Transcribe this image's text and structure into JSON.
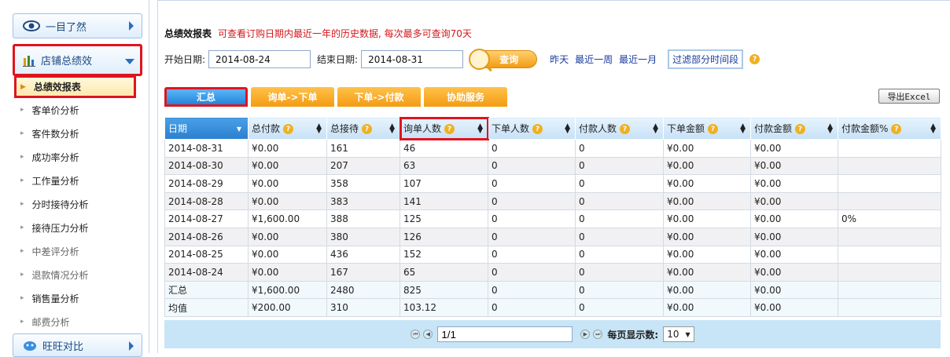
{
  "sidebar": {
    "overview_label": "一目了然",
    "shop_perf_label": "店铺总绩效",
    "items": [
      {
        "label": "总绩效报表"
      },
      {
        "label": "客单价分析"
      },
      {
        "label": "客件数分析"
      },
      {
        "label": "成功率分析"
      },
      {
        "label": "工作量分析"
      },
      {
        "label": "分时接待分析"
      },
      {
        "label": "接待压力分析"
      },
      {
        "label": "中差评分析"
      },
      {
        "label": "退款情况分析"
      },
      {
        "label": "销售量分析"
      },
      {
        "label": "邮费分析"
      }
    ],
    "wangwang_label": "旺旺对比"
  },
  "header": {
    "title": "总绩效报表",
    "note": "可查看订购日期内最近一年的历史数据, 每次最多可查询70天"
  },
  "filter": {
    "start_label": "开始日期:",
    "start_value": "2014-08-24",
    "end_label": "结束日期:",
    "end_value": "2014-08-31",
    "query_label": "查询",
    "yesterday": "昨天",
    "last_week": "最近一周",
    "last_month": "最近一月",
    "time_filter": "过滤部分时间段"
  },
  "tabs": [
    {
      "label": "汇总"
    },
    {
      "label": "询单->下单"
    },
    {
      "label": "下单->付款"
    },
    {
      "label": "协助服务"
    }
  ],
  "export_label": "导出Excel",
  "table": {
    "headers": [
      "日期",
      "总付款",
      "总接待",
      "询单人数",
      "下单人数",
      "付款人数",
      "下单金额",
      "付款金额",
      "付款金额%"
    ],
    "rows": [
      [
        "2014-08-31",
        "¥0.00",
        "161",
        "46",
        "0",
        "0",
        "¥0.00",
        "¥0.00",
        ""
      ],
      [
        "2014-08-30",
        "¥0.00",
        "207",
        "63",
        "0",
        "0",
        "¥0.00",
        "¥0.00",
        ""
      ],
      [
        "2014-08-29",
        "¥0.00",
        "358",
        "107",
        "0",
        "0",
        "¥0.00",
        "¥0.00",
        ""
      ],
      [
        "2014-08-28",
        "¥0.00",
        "383",
        "141",
        "0",
        "0",
        "¥0.00",
        "¥0.00",
        ""
      ],
      [
        "2014-08-27",
        "¥1,600.00",
        "388",
        "125",
        "0",
        "0",
        "¥0.00",
        "¥0.00",
        "0%"
      ],
      [
        "2014-08-26",
        "¥0.00",
        "380",
        "126",
        "0",
        "0",
        "¥0.00",
        "¥0.00",
        ""
      ],
      [
        "2014-08-25",
        "¥0.00",
        "436",
        "152",
        "0",
        "0",
        "¥0.00",
        "¥0.00",
        ""
      ],
      [
        "2014-08-24",
        "¥0.00",
        "167",
        "65",
        "0",
        "0",
        "¥0.00",
        "¥0.00",
        ""
      ],
      [
        "汇总",
        "¥1,600.00",
        "2480",
        "825",
        "0",
        "0",
        "¥0.00",
        "¥0.00",
        ""
      ],
      [
        "均值",
        "¥200.00",
        "310",
        "103.12",
        "0",
        "0",
        "¥0.00",
        "¥0.00",
        ""
      ]
    ]
  },
  "pager": {
    "page_value": "1/1",
    "per_page_label": "每页显示数:",
    "per_page_value": "10"
  },
  "colors": {
    "accent_blue": "#2a7fcf",
    "tab_orange": "#f39c12",
    "highlight_red": "#e0141f",
    "note_red": "#d4161c"
  }
}
